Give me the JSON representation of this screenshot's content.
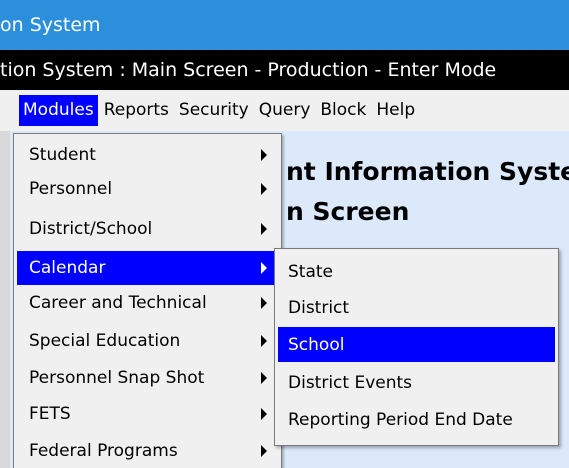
{
  "window": {
    "title": "on System",
    "caption": "tion System : Main Screen  -  Production  -  Enter Mode"
  },
  "menubar": {
    "items": [
      {
        "label": "Modules",
        "active": true
      },
      {
        "label": "Reports"
      },
      {
        "label": "Security"
      },
      {
        "label": "Query"
      },
      {
        "label": "Block"
      },
      {
        "label": "Help"
      }
    ]
  },
  "content": {
    "heading_line1": "nt Information Syste",
    "heading_line2": "n Screen"
  },
  "modules_menu": {
    "items": [
      {
        "label": "Student",
        "has_submenu": true
      },
      {
        "label": "Personnel",
        "has_submenu": true
      },
      {
        "label": "District/School",
        "has_submenu": true
      },
      {
        "label": "Calendar",
        "has_submenu": true,
        "selected": true
      },
      {
        "label": "Career and Technical",
        "has_submenu": true
      },
      {
        "label": "Special Education",
        "has_submenu": true
      },
      {
        "label": "Personnel Snap Shot",
        "has_submenu": true
      },
      {
        "label": "FETS",
        "has_submenu": true
      },
      {
        "label": "Federal Programs",
        "has_submenu": true
      }
    ]
  },
  "calendar_submenu": {
    "items": [
      {
        "label": "State"
      },
      {
        "label": "District"
      },
      {
        "label": "School",
        "selected": true
      },
      {
        "label": "District Events"
      },
      {
        "label": "Reporting Period End Date"
      }
    ]
  },
  "colors": {
    "titlebar": "#2b8fdc",
    "captionbar": "#000000",
    "selection": "#0000ff",
    "menu_bg": "#f0f0f0",
    "content_bg": "#dbe9fb"
  }
}
